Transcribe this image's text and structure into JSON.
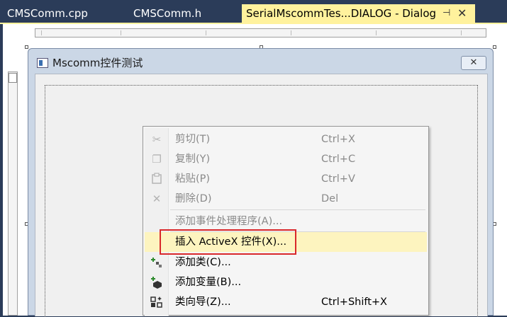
{
  "tabs": [
    {
      "label": "CMSComm.cpp"
    },
    {
      "label": "CMSComm.h"
    },
    {
      "label": "SerialMscommTes...DIALOG - Dialog",
      "active": true
    }
  ],
  "tab_controls": {
    "pin": "⊣",
    "close": "✕"
  },
  "dialog": {
    "title": "Mscomm控件测试",
    "close_glyph": "✕"
  },
  "context_menu": {
    "items": [
      {
        "label": "剪切(T)",
        "shortcut": "Ctrl+X",
        "icon": "scissors-icon",
        "glyph": "✂",
        "disabled": true
      },
      {
        "label": "复制(Y)",
        "shortcut": "Ctrl+C",
        "icon": "copy-icon",
        "glyph": "❐",
        "disabled": true
      },
      {
        "label": "粘贴(P)",
        "shortcut": "Ctrl+V",
        "icon": "paste-icon",
        "glyph": "📋",
        "disabled": true
      },
      {
        "label": "删除(D)",
        "shortcut": "Del",
        "icon": "delete-icon",
        "glyph": "✕",
        "disabled": true
      },
      {
        "label": "添加事件处理程序(A)...",
        "shortcut": "",
        "icon": "",
        "disabled": true
      },
      {
        "label": "插入 ActiveX 控件(X)...",
        "shortcut": "",
        "icon": "",
        "highlighted": true
      },
      {
        "label": "添加类(C)...",
        "shortcut": "",
        "icon": "add-class-icon",
        "glyph": "✚"
      },
      {
        "label": "添加变量(B)...",
        "shortcut": "",
        "icon": "add-variable-icon",
        "glyph": "◆"
      },
      {
        "label": "类向导(Z)...",
        "shortcut": "Ctrl+Shift+X",
        "icon": "class-wizard-icon",
        "glyph": "▦"
      }
    ]
  },
  "colors": {
    "tab_bar": "#2b3c59",
    "active_tab": "#fff29d",
    "highlight": "#fdf4bf",
    "callout": "#d9282b"
  }
}
